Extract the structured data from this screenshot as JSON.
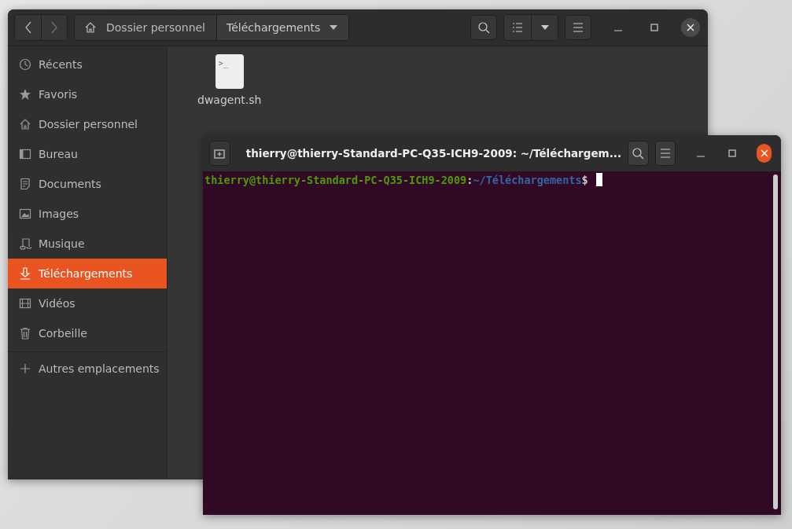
{
  "files_window": {
    "breadcrumbs": [
      {
        "label": "Dossier personnel",
        "selected": false
      },
      {
        "label": "Téléchargements",
        "selected": true
      }
    ],
    "sidebar": {
      "items": [
        {
          "label": "Récents",
          "selected": false
        },
        {
          "label": "Favoris",
          "selected": false
        },
        {
          "label": "Dossier personnel",
          "selected": false
        },
        {
          "label": "Bureau",
          "selected": false
        },
        {
          "label": "Documents",
          "selected": false
        },
        {
          "label": "Images",
          "selected": false
        },
        {
          "label": "Musique",
          "selected": false
        },
        {
          "label": "Téléchargements",
          "selected": true
        },
        {
          "label": "Vidéos",
          "selected": false
        },
        {
          "label": "Corbeille",
          "selected": false
        }
      ],
      "other_locations": "Autres emplacements"
    },
    "files": [
      {
        "name": "dwagent.sh",
        "icon_text": ">_"
      }
    ]
  },
  "terminal": {
    "title": "thierry@thierry-Standard-PC-Q35-ICH9-2009: ~/Téléchargem...",
    "prompt": {
      "user_host": "thierry@thierry-Standard-PC-Q35-ICH9-2009",
      "separator": ":",
      "path": "~/Téléchargements",
      "symbol": "$"
    }
  }
}
